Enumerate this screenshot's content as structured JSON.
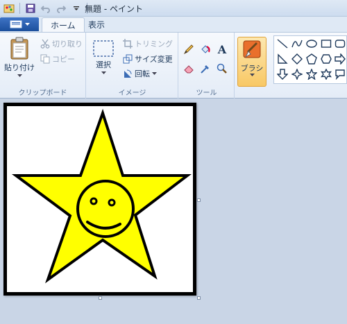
{
  "window": {
    "title": "無題 - ペイント"
  },
  "tabs": {
    "home": "ホーム",
    "view": "表示"
  },
  "clipboard": {
    "paste": "貼り付け",
    "cut": "切り取り",
    "copy": "コピー",
    "label": "クリップボード"
  },
  "image": {
    "select": "選択",
    "crop": "トリミング",
    "resize": "サイズ変更",
    "rotate": "回転",
    "label": "イメージ"
  },
  "tools": {
    "label": "ツール",
    "text_icon": "A"
  },
  "brush": {
    "label": "ブラシ"
  },
  "colors": {
    "star_fill": "#ffff00",
    "star_stroke": "#000000",
    "accent": "#f8c865"
  }
}
